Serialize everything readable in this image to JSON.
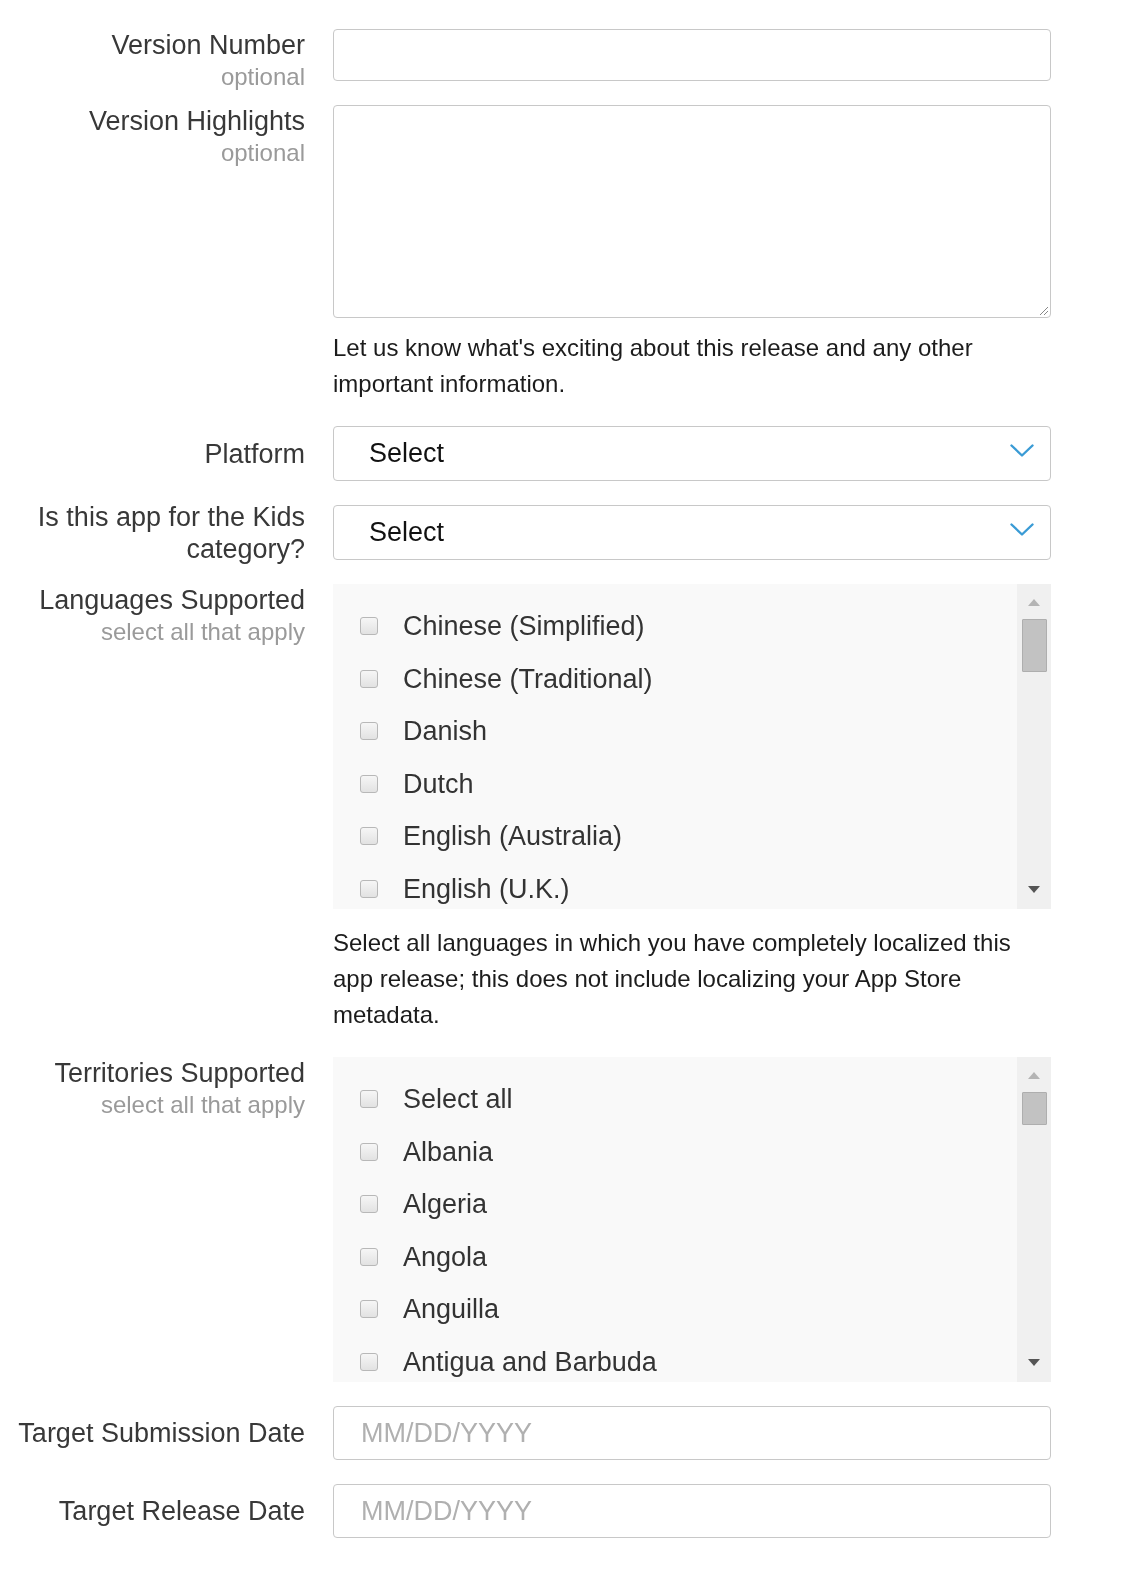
{
  "form": {
    "rows": [
      {
        "kind": "text",
        "label": "Version Number",
        "sublabel": "optional"
      },
      {
        "kind": "textarea",
        "label": "Version Highlights",
        "sublabel": "optional",
        "help": "Let us know what's exciting about this release and any other important information."
      },
      {
        "kind": "select",
        "label": "Platform",
        "value": "Select"
      },
      {
        "kind": "select",
        "label": "Is this app for the Kids category?",
        "value": "Select"
      },
      {
        "kind": "checklist",
        "label": "Languages Supported",
        "sublabel": "select all that apply",
        "options": [
          {
            "label": "Chinese (Simplified)",
            "checked": false
          },
          {
            "label": "Chinese (Traditional)",
            "checked": false
          },
          {
            "label": "Danish",
            "checked": false
          },
          {
            "label": "Dutch",
            "checked": false
          },
          {
            "label": "English (Australia)",
            "checked": false
          },
          {
            "label": "English (U.K.)",
            "checked": false
          }
        ],
        "help": "Select all languages in which you have completely localized this app release; this does not include localizing your App Store metadata."
      },
      {
        "kind": "checklist",
        "label": "Territories Supported",
        "sublabel": "select all that apply",
        "options": [
          {
            "label": "Select all",
            "checked": false
          },
          {
            "label": "Albania",
            "checked": false
          },
          {
            "label": "Algeria",
            "checked": false
          },
          {
            "label": "Angola",
            "checked": false
          },
          {
            "label": "Anguilla",
            "checked": false
          },
          {
            "label": "Antigua and Barbuda",
            "checked": false
          }
        ]
      },
      {
        "kind": "date",
        "label": "Target Submission Date",
        "placeholder": "MM/DD/YYYY"
      },
      {
        "kind": "date",
        "label": "Target Release Date",
        "placeholder": "MM/DD/YYYY"
      }
    ]
  }
}
